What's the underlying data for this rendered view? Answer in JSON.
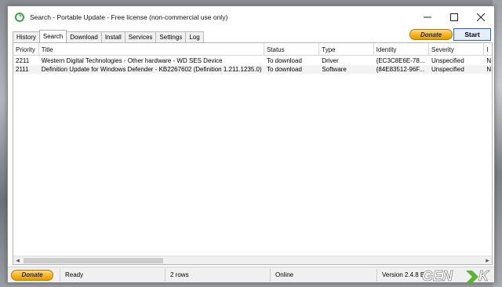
{
  "window": {
    "title": "Search - Portable Update  - Free license (non-commercial use only)",
    "app_icon": "portable-update-icon",
    "controls": {
      "minimize": "—",
      "maximize": "☐",
      "close": "✕"
    }
  },
  "tabs": [
    {
      "label": "History",
      "active": false
    },
    {
      "label": "Search",
      "active": true
    },
    {
      "label": "Download",
      "active": false
    },
    {
      "label": "Install",
      "active": false
    },
    {
      "label": "Services",
      "active": false
    },
    {
      "label": "Settings",
      "active": false
    },
    {
      "label": "Log",
      "active": false
    }
  ],
  "toolbar": {
    "donate_label": "Donate",
    "start_label": "Start"
  },
  "grid": {
    "columns": [
      "Priority",
      "Title",
      "Status",
      "Type",
      "Identity",
      "Severity",
      "I"
    ],
    "rows": [
      [
        "2211",
        "Western Digital Technologies - Other hardware - WD SES Device",
        "To download",
        "Driver",
        "{EC3C8E6E-78...",
        "Unspecified",
        "N"
      ],
      [
        "2111",
        "Definition Update for Windows Defender - KB2267602 (Definition 1.211.1235.0)",
        "To download",
        "Software",
        "{84E83512-96F...",
        "Unspecified",
        "N"
      ]
    ]
  },
  "statusbar": {
    "donate_label": "Donate",
    "state": "Ready",
    "rows": "2 rows",
    "connection": "Online",
    "version": "Version 2.4.8 B"
  },
  "watermark": {
    "text": "GENK"
  },
  "colors": {
    "donate": "#f6b41e",
    "start_border": "#2a64c8",
    "watermark_green": "#5cb531"
  }
}
